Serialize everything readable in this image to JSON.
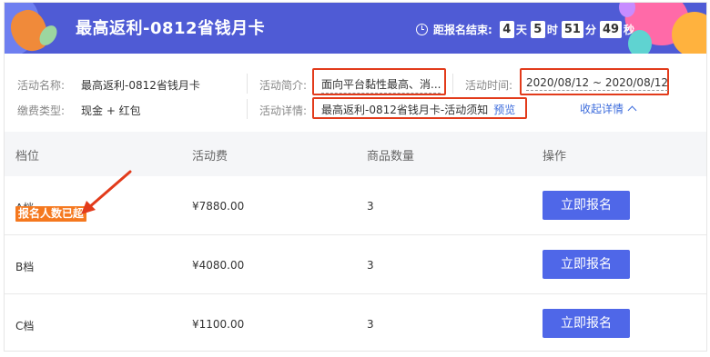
{
  "banner": {
    "title": "最高返利-0812省钱月卡",
    "countdown": {
      "label": "距报名结束:",
      "days": "4",
      "days_unit": "天",
      "hours": "5",
      "hours_unit": "时",
      "minutes": "51",
      "minutes_unit": "分",
      "seconds": "49",
      "seconds_unit": "秒"
    }
  },
  "info": {
    "name_label": "活动名称:",
    "name_value": "最高返利-0812省钱月卡",
    "fee_type_label": "缴费类型:",
    "fee_type_value": "现金 + 红包",
    "intro_label": "活动简介:",
    "intro_value": "面向平台黏性最高、消...",
    "detail_label": "活动详情:",
    "detail_value": "最高返利-0812省钱月卡-活动须知",
    "preview_link": "预览",
    "time_label": "活动时间:",
    "time_value": "2020/08/12 ~ 2020/08/12",
    "collapse_link": "收起详情"
  },
  "table": {
    "headers": [
      "档位",
      "活动费",
      "商品数量",
      "操作"
    ],
    "rows": [
      {
        "tier": "A档",
        "fee": "¥7880.00",
        "qty": "3",
        "action": "立即报名",
        "badge": "报名人数已超"
      },
      {
        "tier": "B档",
        "fee": "¥4080.00",
        "qty": "3",
        "action": "立即报名"
      },
      {
        "tier": "C档",
        "fee": "¥1100.00",
        "qty": "3",
        "action": "立即报名"
      }
    ]
  },
  "colors": {
    "banner": "#4f5bd5",
    "primary_button": "#4f67e8",
    "link": "#3d6cdc",
    "highlight_box": "#e23b1b",
    "badge": "#f5781e"
  }
}
